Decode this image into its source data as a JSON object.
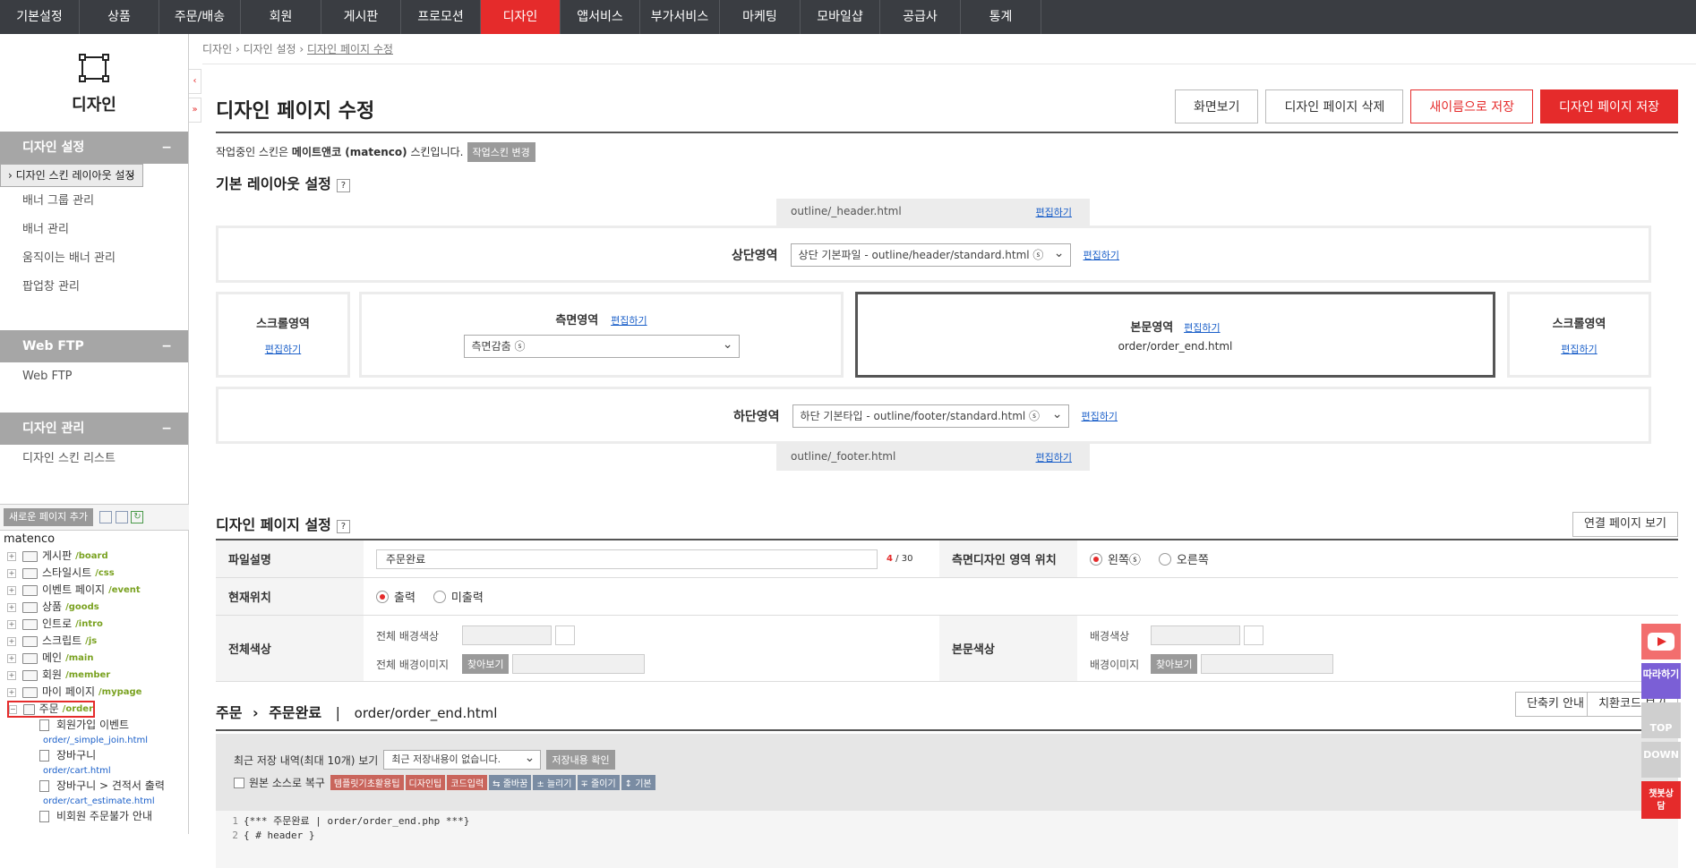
{
  "nav": [
    "기본설정",
    "상품",
    "주문/배송",
    "회원",
    "게시판",
    "프로모션",
    "디자인",
    "앱서비스",
    "부가서비스",
    "마케팅",
    "모바일샵",
    "공급사",
    "통계"
  ],
  "nav_active_index": 6,
  "sidebar": {
    "logo_label": "디자인",
    "sections": [
      {
        "title": "디자인 설정",
        "items": [
          "› 디자인 스킨 레이아웃 설정",
          "배너 그룹 관리",
          "배너 관리",
          "움직이는 배너 관리",
          "팝업창 관리"
        ]
      },
      {
        "title": "Web FTP",
        "items": [
          "Web FTP"
        ]
      },
      {
        "title": "디자인 관리",
        "items": [
          "디자인 스킨 리스트"
        ]
      }
    ],
    "collapse_symbol": "−",
    "add_page_btn": "새로운 페이지 추가"
  },
  "tree": {
    "root": "matenco",
    "folders": [
      {
        "name": "게시판",
        "path": "/board"
      },
      {
        "name": "스타일시트",
        "path": "/css"
      },
      {
        "name": "이벤트 페이지",
        "path": "/event"
      },
      {
        "name": "상품",
        "path": "/goods"
      },
      {
        "name": "인트로",
        "path": "/intro"
      },
      {
        "name": "스크립트",
        "path": "/js"
      },
      {
        "name": "메인",
        "path": "/main"
      },
      {
        "name": "회원",
        "path": "/member"
      },
      {
        "name": "마이 페이지",
        "path": "/mypage"
      },
      {
        "name": "주문",
        "path": "/order"
      }
    ],
    "files": [
      {
        "name": "회원가입 이벤트",
        "path": "order/_simple_join.html"
      },
      {
        "name": "장바구니",
        "path": "order/cart.html"
      },
      {
        "name": "장바구니 > 견적서 출력",
        "path": "order/cart_estimate.html"
      },
      {
        "name": "비회원 주문불가 안내",
        "path": ""
      }
    ]
  },
  "breadcrumb": [
    "디자인",
    "디자인 설정",
    "디자인 페이지 수정"
  ],
  "page": {
    "title": "디자인 페이지 수정",
    "buttons": [
      "화면보기",
      "디자인 페이지 삭제",
      "새이름으로 저장",
      "디자인 페이지 저장"
    ],
    "skin_note_pre": "작업중인 스킨은 ",
    "skin_name": "메이트앤코 (matenco)",
    "skin_note_post": " 스킨입니다.",
    "skin_change_btn": "작업스킨 변경"
  },
  "layout": {
    "heading": "기본 레이아웃 설정",
    "help": "?",
    "edit": "편집하기",
    "header_file": "outline/_header.html",
    "footer_file": "outline/_footer.html",
    "top_label": "상단영역",
    "top_select": "상단 기본파일 - outline/header/standard.html ⓢ",
    "scroll_label": "스크롤영역",
    "side_label": "측면영역",
    "side_select": "측면감춤 ⓢ",
    "body_label": "본문영역",
    "body_file": "order/order_end.html",
    "bottom_label": "하단영역",
    "bottom_select": "하단 기본타입 - outline/footer/standard.html ⓢ"
  },
  "settings": {
    "heading": "디자인 페이지 설정",
    "link_btn": "연결 페이지 보기",
    "file_desc_label": "파일설명",
    "file_desc_value": "주문완료",
    "file_desc_count": "4",
    "file_desc_max": "/ 30",
    "side_pos_label": "측면디자인 영역 위치",
    "side_pos_left": "왼쪽ⓢ",
    "side_pos_right": "오른쪽",
    "cur_pos_label": "현재위치",
    "cur_pos_on": "출력",
    "cur_pos_off": "미출력",
    "all_color_label": "전체색상",
    "all_bg_color": "전체 배경색상",
    "all_bg_image": "전체 배경이미지",
    "find_btn": "찾아보기",
    "body_color_label": "본문색상",
    "body_bg_color": "배경색상",
    "body_bg_image": "배경이미지"
  },
  "editor": {
    "crumb_a": "주문",
    "crumb_b": "주문완료",
    "file": "order/order_end.html",
    "shortcut_btn": "단축키 안내",
    "replace_btn": "치환코드 보기",
    "recent_label": "최근 저장 내역(최대 10개) 보기",
    "recent_select": "최근 저장내용이 없습니다.",
    "recent_btn": "저장내용 확인",
    "restore_label": "원본 소스로 복구",
    "tags": [
      "템플릿기초활용팁",
      "디자인팁",
      "코드입력",
      "⇆ 줄바꿈",
      "± 늘리기",
      "∓ 줄이기",
      "↕ 기본"
    ],
    "lines": [
      "{*** 주문완료 | order/order_end.php ***}",
      "{ # header }"
    ]
  },
  "floaters": [
    "따라하기",
    "TOP",
    "DOWN",
    "챗봇상담"
  ]
}
